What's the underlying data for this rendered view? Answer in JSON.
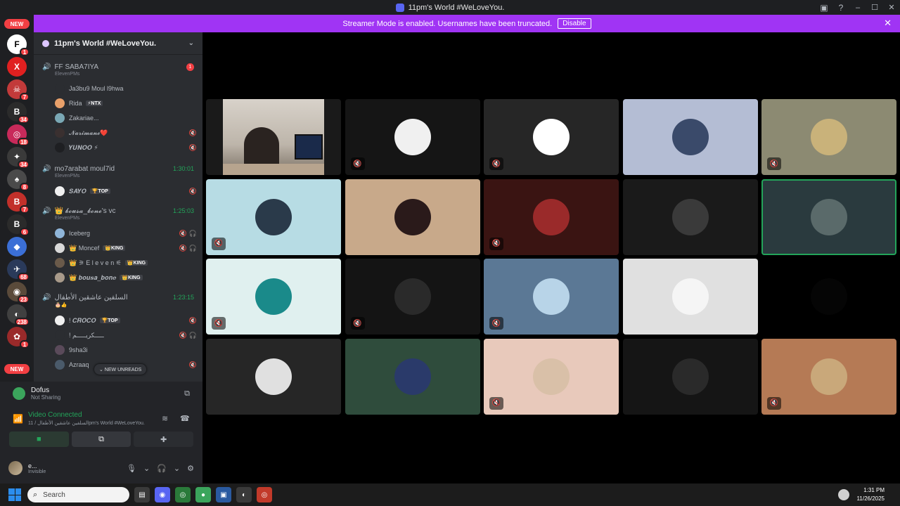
{
  "window": {
    "title": "11pm's World #WeLoveYou."
  },
  "banner": {
    "text": "Streamer Mode is enabled. Usernames have been truncated.",
    "button": "Disable"
  },
  "rail": {
    "new_top": "NEW",
    "new_bottom": "NEW",
    "servers": [
      {
        "glyph": "F",
        "badge": "1",
        "color": "#ffffff"
      },
      {
        "glyph": "X",
        "badge": "",
        "color": "#e02020"
      },
      {
        "glyph": "☠",
        "badge": "7",
        "color": "#c23a3a"
      },
      {
        "glyph": "B",
        "badge": "34",
        "color": "#2b2b2b"
      },
      {
        "glyph": "◎",
        "badge": "18",
        "color": "#c82a5a"
      },
      {
        "glyph": "✦",
        "badge": "34",
        "color": "#3a3a3a"
      },
      {
        "glyph": "♠",
        "badge": "8",
        "color": "#4a4a4a"
      },
      {
        "glyph": "B",
        "badge": "7",
        "color": "#c2302a"
      },
      {
        "glyph": "B",
        "badge": "6",
        "color": "#2b2b2b"
      },
      {
        "glyph": "◆",
        "badge": "",
        "color": "#3b6fd6"
      },
      {
        "glyph": "✈",
        "badge": "68",
        "color": "#2a3a5a"
      },
      {
        "glyph": "◉",
        "badge": "23",
        "color": "#5a4a3a"
      },
      {
        "glyph": "◐",
        "badge": "238",
        "color": "#404040"
      },
      {
        "glyph": "✿",
        "badge": "1",
        "color": "#9a2a2a"
      }
    ]
  },
  "server": {
    "name": "11pm's World #WeLoveYou."
  },
  "channels": [
    {
      "name": "FF SABA7IYA",
      "sub": "ElevenPMs",
      "badge": "1",
      "time": ""
    },
    {
      "name": "mo7arabat moul7id",
      "sub": "ElevenPMs",
      "badge": "",
      "time": "1:30:01"
    },
    {
      "name": "👑 𝓫𝓸𝓾𝓼𝓪_𝓫𝓸𝓷𝓮's vc",
      "sub": "ElevenPMs",
      "badge": "",
      "time": "1:25:03"
    },
    {
      "name": "السلفين عاشقين الأطفال",
      "sub": "🎂👍",
      "badge": "",
      "time": "1:23:15"
    }
  ],
  "members": [
    {
      "name": "Ja3bu9 Moul l9hwa",
      "tag": "",
      "icons": "",
      "color": "#2b2d31"
    },
    {
      "name": "Rida",
      "tag": "⚡NTX",
      "icons": "",
      "color": "#e8a06a"
    },
    {
      "name": "Zakariae...",
      "tag": "",
      "icons": "",
      "color": "#7aa8b5"
    },
    {
      "name": "𝓝𝓪𝓻𝓲𝓶𝓪𝓷𝓮❤️",
      "tag": "",
      "icons": "🔇",
      "color": "#3a3030"
    },
    {
      "name": "𝒀𝑼𝑵𝑶𝑶 ⚡",
      "tag": "",
      "icons": "🔇",
      "color": "#1e1f22"
    },
    {
      "name": "𝑺𝑨𝒀𝑶",
      "tag": "🏆TOP",
      "icons": "🔇",
      "color": "#f0f0f0"
    },
    {
      "name": "Iceberg",
      "tag": "",
      "icons": "🔇🎧",
      "color": "#8fb5d9"
    },
    {
      "name": "👑 Moncef",
      "tag": "👑KING",
      "icons": "🔇🎧",
      "color": "#d9d9d9"
    },
    {
      "name": "👑 ⚞ E l e v e n ⚟",
      "tag": "👑KING",
      "icons": "",
      "color": "#6a5a4a"
    },
    {
      "name": "👑 𝒃𝒐𝒖𝒔𝒂_𝒃𝒐𝒏𝒆",
      "tag": "👑KING",
      "icons": "",
      "color": "#a89a8a"
    },
    {
      "name": "! 𝑪𝑹𝑶𝑪𝑶",
      "tag": "🏆TOP",
      "icons": "🔇",
      "color": "#f0f0f0"
    },
    {
      "name": "! ـــــكريـــــم",
      "tag": "",
      "icons": "🔇🎧",
      "color": "#2b2d31"
    },
    {
      "name": "9sha3i",
      "tag": "",
      "icons": "",
      "color": "#5a4a5a"
    },
    {
      "name": "Azraaq",
      "tag": "",
      "icons": "🔇",
      "color": "#4a5a6a"
    }
  ],
  "new_unreads": "⌄ NEW UNREADS",
  "activity": {
    "name": "Dofus",
    "status": "Not Sharing"
  },
  "rtc": {
    "status": "Video Connected",
    "channel": "السلفين عاشقين الأطفال / 11pm's World #WeLoveYou."
  },
  "user": {
    "name": "e...",
    "status": "Invisible"
  },
  "tiles": [
    {
      "bg": "#1a1a1a",
      "avatar": "",
      "video": true,
      "muted": false,
      "speaking": false
    },
    {
      "bg": "#151515",
      "avatar": "#f0f0f0",
      "video": false,
      "muted": true,
      "speaking": false
    },
    {
      "bg": "#262626",
      "avatar": "#ffffff",
      "video": false,
      "muted": true,
      "speaking": false
    },
    {
      "bg": "#b4bdd4",
      "avatar": "#3a4a6a",
      "video": false,
      "muted": false,
      "speaking": false
    },
    {
      "bg": "#8c8a72",
      "avatar": "#c9b27a",
      "video": false,
      "muted": true,
      "speaking": false
    },
    {
      "bg": "#b7dce4",
      "avatar": "#2a3a4a",
      "video": false,
      "muted": true,
      "speaking": false
    },
    {
      "bg": "#c8a98a",
      "avatar": "#2a1a1a",
      "video": false,
      "muted": false,
      "speaking": false
    },
    {
      "bg": "#3a1412",
      "avatar": "#9a2a2a",
      "video": false,
      "muted": true,
      "speaking": false
    },
    {
      "bg": "#1a1a1a",
      "avatar": "#3a3a3a",
      "video": false,
      "muted": false,
      "speaking": false
    },
    {
      "bg": "#2a3a3e",
      "avatar": "#5a6a6a",
      "video": false,
      "muted": false,
      "speaking": true
    },
    {
      "bg": "#e0f0ef",
      "avatar": "#1a8a8a",
      "video": false,
      "muted": true,
      "speaking": false
    },
    {
      "bg": "#141414",
      "avatar": "#2a2a2a",
      "video": false,
      "muted": true,
      "speaking": false
    },
    {
      "bg": "#5b7895",
      "avatar": "#b8d4e8",
      "video": false,
      "muted": true,
      "speaking": false
    },
    {
      "bg": "#e0e0e0",
      "avatar": "#f5f5f5",
      "video": false,
      "muted": false,
      "speaking": false
    },
    {
      "bg": "#000000",
      "avatar": "#050505",
      "video": false,
      "muted": false,
      "speaking": false
    },
    {
      "bg": "#262626",
      "avatar": "#e0e0e0",
      "video": false,
      "muted": false,
      "speaking": false
    },
    {
      "bg": "#2f4c3c",
      "avatar": "#2a3a6a",
      "video": false,
      "muted": false,
      "speaking": false
    },
    {
      "bg": "#e8c9bb",
      "avatar": "#d9c0a8",
      "video": false,
      "muted": true,
      "speaking": false
    },
    {
      "bg": "#151515",
      "avatar": "#2a2a2a",
      "video": false,
      "muted": false,
      "speaking": false
    },
    {
      "bg": "#b57a55",
      "avatar": "#c9a87a",
      "video": false,
      "muted": true,
      "speaking": false
    }
  ],
  "taskbar": {
    "search_placeholder": "Search",
    "time": "1:31 PM",
    "date": "11/26/2025"
  }
}
